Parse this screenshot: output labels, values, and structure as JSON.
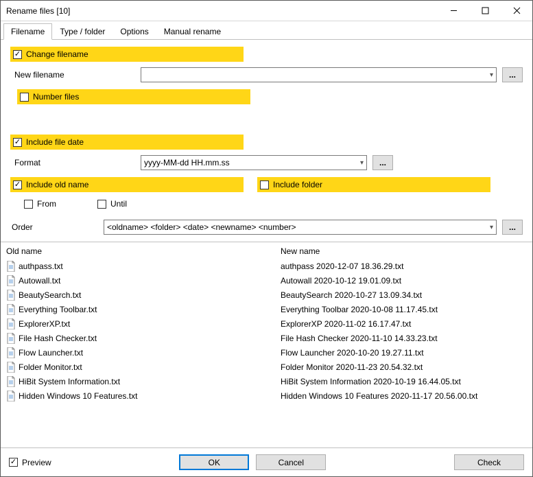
{
  "title": "Rename files [10]",
  "tabs": [
    "Filename",
    "Type / folder",
    "Options",
    "Manual rename"
  ],
  "section": {
    "change_filename": "Change filename",
    "new_filename": "New filename",
    "number_files": "Number files",
    "include_file_date": "Include file date",
    "format": "Format",
    "format_value": "yyyy-MM-dd HH.mm.ss",
    "include_old_name": "Include old name",
    "include_folder": "Include folder",
    "from": "From",
    "until": "Until",
    "order": "Order",
    "order_value": "<oldname> <folder> <date> <newname> <number>"
  },
  "columns": {
    "old": "Old name",
    "new": "New name"
  },
  "files": [
    {
      "old": "authpass.txt",
      "new": "authpass 2020-12-07 18.36.29.txt"
    },
    {
      "old": "Autowall.txt",
      "new": "Autowall 2020-10-12 19.01.09.txt"
    },
    {
      "old": "BeautySearch.txt",
      "new": "BeautySearch 2020-10-27 13.09.34.txt"
    },
    {
      "old": "Everything Toolbar.txt",
      "new": "Everything Toolbar 2020-10-08 11.17.45.txt"
    },
    {
      "old": "ExplorerXP.txt",
      "new": "ExplorerXP 2020-11-02 16.17.47.txt"
    },
    {
      "old": "File Hash Checker.txt",
      "new": "File Hash Checker 2020-11-10 14.33.23.txt"
    },
    {
      "old": "Flow Launcher.txt",
      "new": "Flow Launcher 2020-10-20 19.27.11.txt"
    },
    {
      "old": "Folder Monitor.txt",
      "new": "Folder Monitor 2020-11-23 20.54.32.txt"
    },
    {
      "old": "HiBit System Information.txt",
      "new": "HiBit System Information 2020-10-19 16.44.05.txt"
    },
    {
      "old": "Hidden Windows 10 Features.txt",
      "new": "Hidden Windows 10 Features 2020-11-17 20.56.00.txt"
    }
  ],
  "footer": {
    "preview": "Preview",
    "ok": "OK",
    "cancel": "Cancel",
    "check": "Check"
  }
}
